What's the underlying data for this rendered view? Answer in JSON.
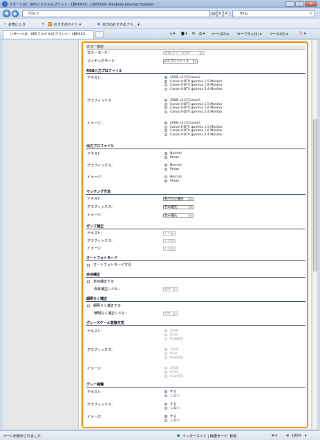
{
  "window": {
    "title": "リモートUI：XPSファイルのプリント：LBPXXXX：LBPXXXX- Windows Internet Explorer",
    "minimize": "–",
    "restore": "□",
    "close": "✕"
  },
  "addressbar": {
    "url": "http://",
    "search_placeholder": "Bing",
    "back": "◀",
    "forward": "▶"
  },
  "favbar": {
    "favorites": "お気に入り",
    "suggested": "おすすめサイト ▾",
    "today": "本日のおすすめアド... ▾"
  },
  "tab": {
    "label": "リモートUI：XPSファイルのプリント：LBPXXX..."
  },
  "commandbar": {
    "page": "ページ(P) ▾",
    "safety": "セーフティ(S) ▾",
    "tools": "ツール(O) ▾",
    "help": "❓ ▾"
  },
  "status": {
    "left": "ページが表示されました",
    "zone": "インターネット | 保護モード: 有効",
    "zoom": "100%"
  },
  "form": {
    "color_section": {
      "title": "カラー設定",
      "color_mode_label": "カラーモード：",
      "color_mode_value": "自動(カラー/白黒)",
      "matching_mode_label": "マッチングモード：",
      "matching_mode_value": "ICCプロファイル"
    },
    "rgb_profile": {
      "title": "RGB入力プロファイル",
      "groups": [
        {
          "label": "テキスト：",
          "options": [
            "sRGB v3.0 [Canon]",
            "Canon HDTV gamma 1.5 Monitor",
            "Canon HDTV gamma 1.8 Monitor",
            "Canon HDTV gamma 2.4 Monitor"
          ],
          "selected": 0
        },
        {
          "label": "グラフィックス：",
          "options": [
            "sRGB v3.0 [Canon]",
            "Canon HDTV gamma 1.5 Monitor",
            "Canon HDTV gamma 1.8 Monitor",
            "Canon HDTV gamma 2.4 Monitor"
          ],
          "selected": 0
        },
        {
          "label": "イメージ：",
          "options": [
            "sRGB v3.0 [Canon]",
            "Canon HDTV gamma 1.5 Monitor",
            "Canon HDTV gamma 1.8 Monitor",
            "Canon HDTV gamma 2.4 Monitor"
          ],
          "selected": 0
        }
      ]
    },
    "output_profile": {
      "title": "出力プロファイル",
      "groups": [
        {
          "label": "テキスト",
          "options": [
            "Normal",
            "Photo"
          ],
          "selected": 0
        },
        {
          "label": "グラフィックス：",
          "options": [
            "Normal",
            "Photo"
          ],
          "selected": 0
        },
        {
          "label": "イメージ：",
          "options": [
            "Normal",
            "Photo"
          ],
          "selected": 1
        }
      ]
    },
    "matching_method": {
      "title": "マッチング方法",
      "rows": [
        {
          "label": "テキスト：",
          "value": "鮮やかさ優先"
        },
        {
          "label": "グラフィックス：",
          "value": "色み優先"
        },
        {
          "label": "イメージ：",
          "value": "色み優先"
        }
      ]
    },
    "gamma": {
      "title": "ガンマ補正",
      "rows": [
        {
          "label": "テキスト：",
          "value": "1.4"
        },
        {
          "label": "グラフィックス：",
          "value": "1.4"
        },
        {
          "label": "イメージ：",
          "value": "1.4"
        }
      ]
    },
    "autophoto": {
      "title": "オートフォトモード",
      "checkbox": "オートフォトモードする"
    },
    "whiteline": {
      "title": "赤目補正",
      "checkbox": "赤目補正する",
      "level_label": "赤目補正レベル：",
      "level_value": "標準"
    },
    "bright": {
      "title": "細明らく補正",
      "checkbox": "細明らく補正する",
      "level_label": "細明らく補正レベル：",
      "level_value": "標準"
    },
    "grayscale": {
      "title": "グレースケール変換方式",
      "groups": [
        {
          "label": "テキスト：",
          "options": [
            "sRGB",
            "NTSC",
            "RGB均等"
          ],
          "selected": 0
        },
        {
          "label": "グラフィックス：",
          "options": [
            "sRGB",
            "NTSC",
            "RGB均等"
          ],
          "selected": 0
        },
        {
          "label": "イメージ：",
          "options": [
            "sRGB",
            "NTSC",
            "RGB均等"
          ],
          "selected": 0
        }
      ]
    },
    "gray_comp": {
      "title": "グレー補償",
      "groups": [
        {
          "label": "テキスト：",
          "options": [
            "する",
            "しない"
          ],
          "selected": 0
        },
        {
          "label": "グラフィックス：",
          "options": [
            "する",
            "しない"
          ],
          "selected": 0
        },
        {
          "label": "イメージ：",
          "options": [
            "する",
            "しない"
          ],
          "selected": 0
        }
      ]
    }
  }
}
